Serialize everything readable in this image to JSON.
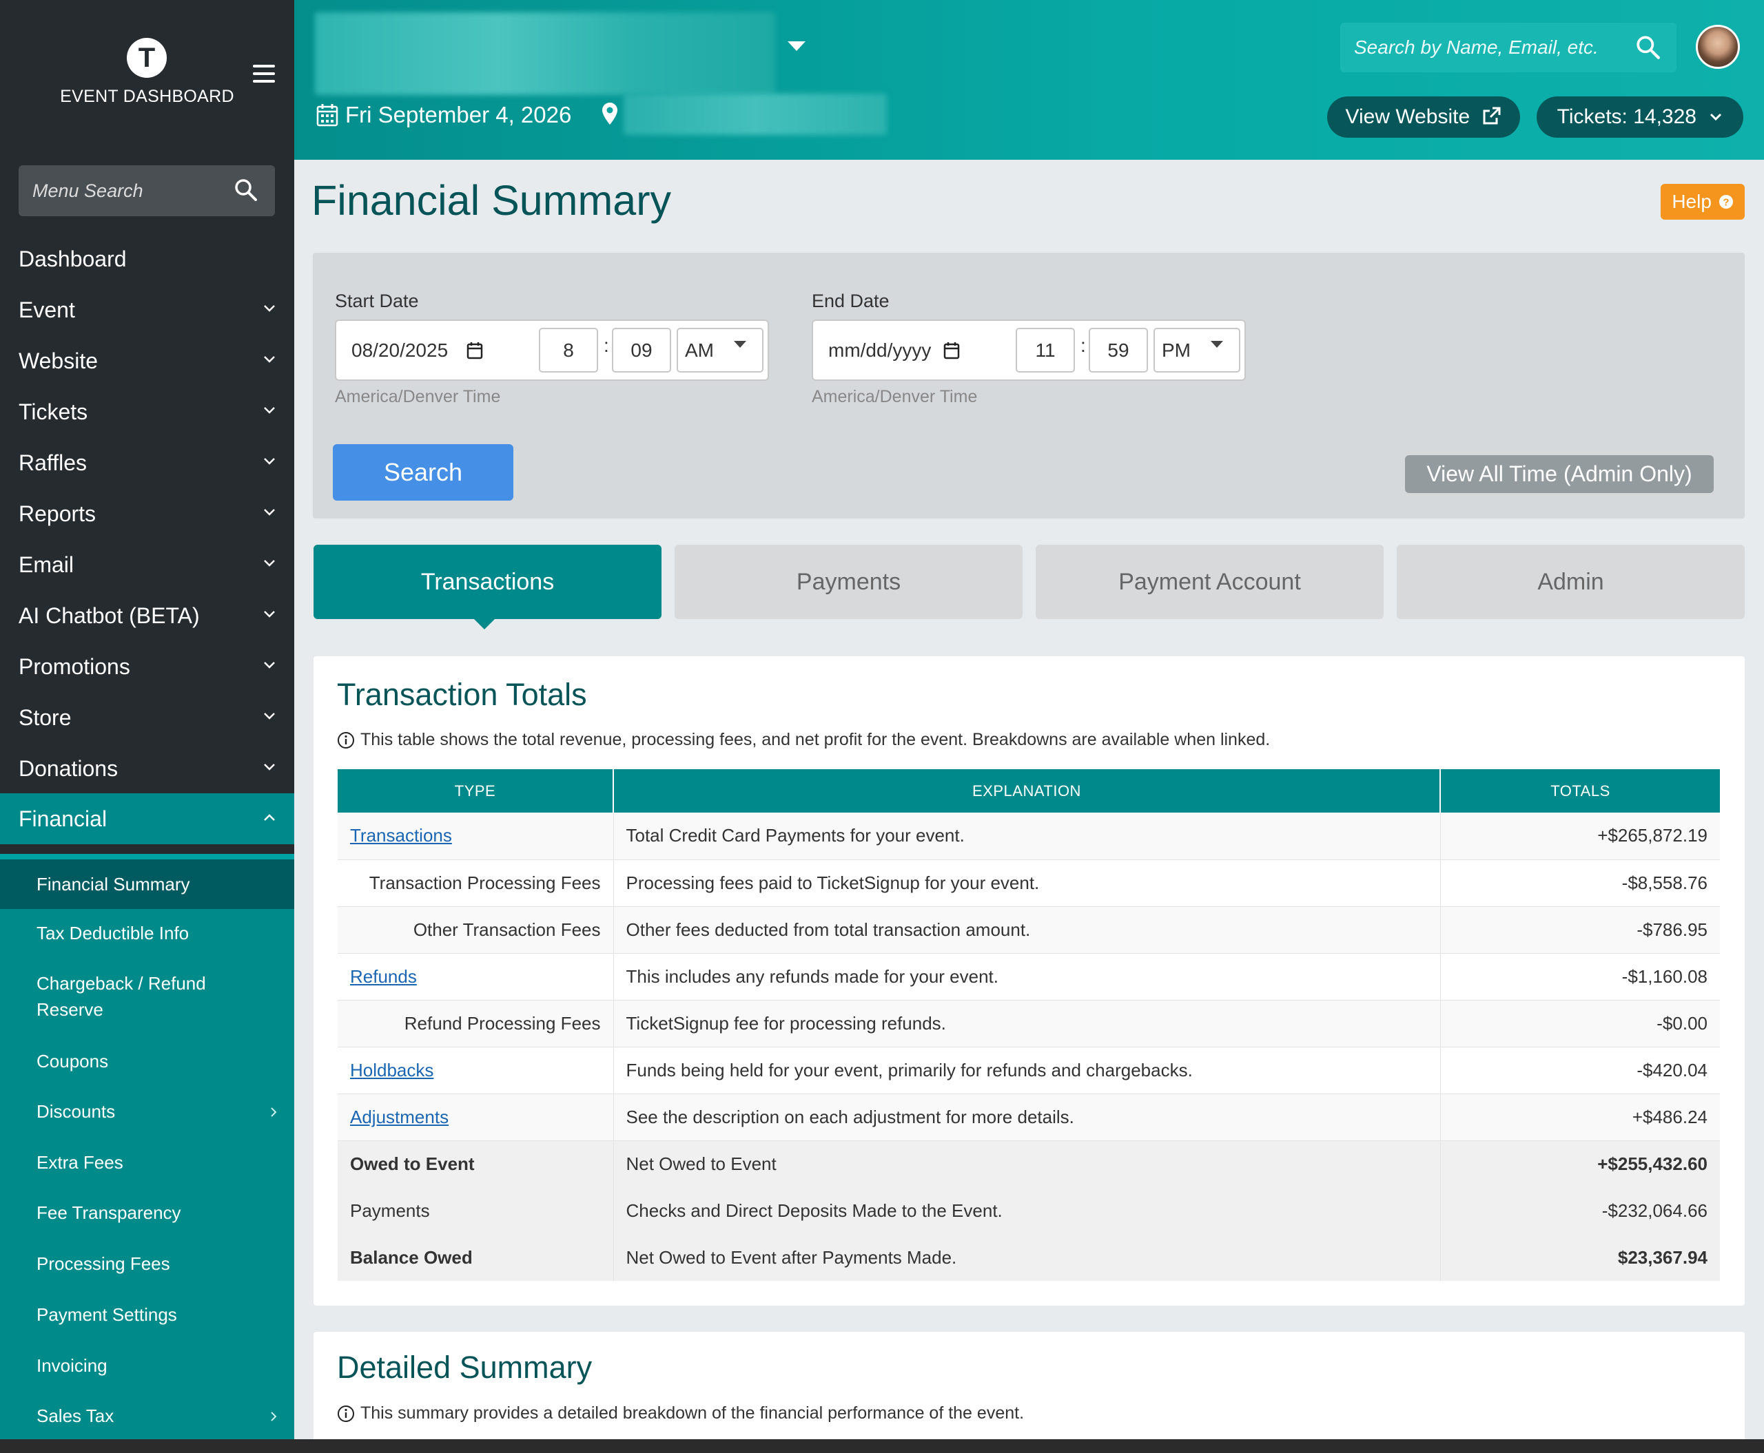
{
  "sidebar": {
    "logo_letter": "T",
    "logo_text": "EVENT DASHBOARD",
    "search_placeholder": "Menu Search",
    "nav": [
      "Dashboard",
      "Event",
      "Website",
      "Tickets",
      "Raffles",
      "Reports",
      "Email",
      "AI Chatbot (BETA)",
      "Promotions",
      "Store",
      "Donations",
      "Financial"
    ],
    "sub": [
      "Financial Summary",
      "Tax Deductible Info",
      "Chargeback / Refund",
      "Reserve",
      "Coupons",
      "Discounts",
      "Extra Fees",
      "Fee Transparency",
      "Processing Fees",
      "Payment Settings",
      "Invoicing",
      "Sales Tax"
    ]
  },
  "header": {
    "date": "Fri September 4, 2026",
    "search_placeholder": "Search by Name, Email, etc.",
    "view_website": "View Website",
    "tickets": "Tickets: 14,328"
  },
  "page": {
    "title": "Financial Summary",
    "help": "Help"
  },
  "filter": {
    "start_label": "Start Date",
    "start_date": "08/20/2025",
    "start_hour": "8",
    "start_min": "09",
    "start_ampm": "AM",
    "end_label": "End Date",
    "end_date": "mm/dd/yyyy",
    "end_hour": "11",
    "end_min": "59",
    "end_ampm": "PM",
    "timezone": "America/Denver Time",
    "colon": ":",
    "search_btn": "Search",
    "all_time_btn": "View All Time (Admin Only)"
  },
  "tabs": [
    "Transactions",
    "Payments",
    "Payment Account",
    "Admin"
  ],
  "totals": {
    "title": "Transaction Totals",
    "desc": "This table shows the total revenue, processing fees, and net profit for the event. Breakdowns are available when linked.",
    "headers": [
      "TYPE",
      "EXPLANATION",
      "TOTALS"
    ],
    "rows": [
      {
        "type": "Transactions",
        "exp": "Total Credit Card Payments for your event.",
        "total": "+$265,872.19"
      },
      {
        "type": "Transaction Processing Fees",
        "exp": "Processing fees paid to TicketSignup for your event.",
        "total": "-$8,558.76"
      },
      {
        "type": "Other Transaction Fees",
        "exp": "Other fees deducted from total transaction amount.",
        "total": "-$786.95"
      },
      {
        "type": "Refunds",
        "exp": "This includes any refunds made for your event.",
        "total": "-$1,160.08"
      },
      {
        "type": "Refund Processing Fees",
        "exp": "TicketSignup fee for processing refunds.",
        "total": "-$0.00"
      },
      {
        "type": "Holdbacks",
        "exp": "Funds being held for your event, primarily for refunds and chargebacks.",
        "total": "-$420.04"
      },
      {
        "type": "Adjustments",
        "exp": "See the description on each adjustment for more details.",
        "total": "+$486.24"
      },
      {
        "type": "Owed to Event",
        "exp": "Net Owed to Event",
        "total": "+$255,432.60"
      },
      {
        "type": "Payments",
        "exp": "Checks and Direct Deposits Made to the Event.",
        "total": "-$232,064.66"
      },
      {
        "type": "Balance Owed",
        "exp": "Net Owed to Event after Payments Made.",
        "total": "$23,367.94"
      }
    ]
  },
  "detailed": {
    "title": "Detailed Summary",
    "desc": "This summary provides a detailed breakdown of the financial performance of the event."
  },
  "colors": {
    "sidebar": "#262b30",
    "teal": "#00898a",
    "title": "#075458",
    "help": "#f6951e",
    "search": "#4590e6"
  }
}
